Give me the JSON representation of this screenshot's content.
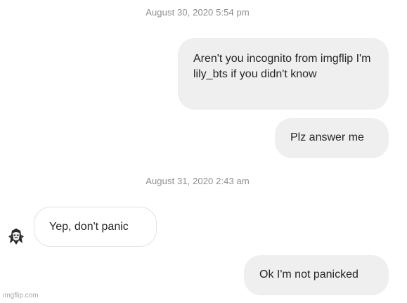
{
  "timestamps": {
    "first": "August 30, 2020 5:54 pm",
    "second": "August 31, 2020 2:43 am"
  },
  "messages": [
    {
      "direction": "sent",
      "text": "Aren't you incognito from imgflip I'm lily_bts if you didn't know"
    },
    {
      "direction": "sent",
      "text": "Plz answer me"
    },
    {
      "direction": "received",
      "text": "Yep, don't panic"
    },
    {
      "direction": "sent",
      "text": "Ok I'm not panicked"
    }
  ],
  "avatar": {
    "icon": "masked-avatar-icon"
  },
  "watermark": "imgflip.com",
  "colors": {
    "sent_bubble": "#efefef",
    "received_border": "#e3e3e3",
    "timestamp": "#8e8e8e"
  }
}
